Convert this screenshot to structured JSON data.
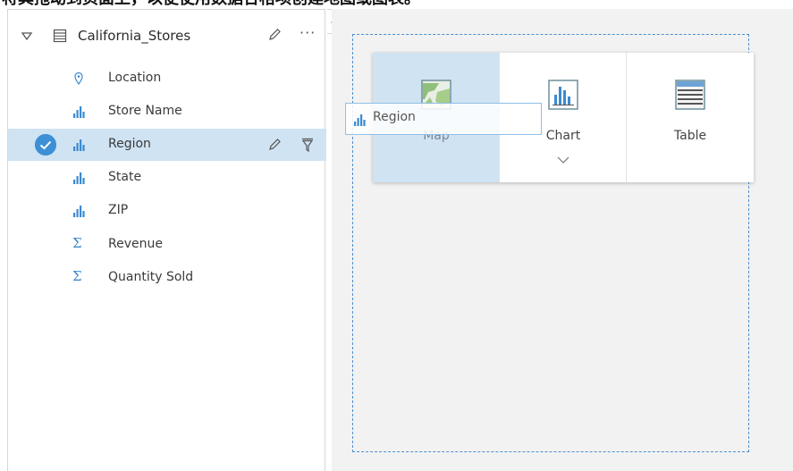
{
  "caption": "将其拖动到页面上，以便使用数据合格项创建地图或图表。",
  "dataset": {
    "name": "California_Stores",
    "more_label": "···"
  },
  "fields": [
    {
      "label": "Location",
      "icon": "location-icon"
    },
    {
      "label": "Store Name",
      "icon": "string-field-icon"
    },
    {
      "label": "Region",
      "icon": "string-field-icon",
      "selected": true
    },
    {
      "label": "State",
      "icon": "string-field-icon"
    },
    {
      "label": "ZIP",
      "icon": "string-field-icon"
    },
    {
      "label": "Revenue",
      "icon": "sigma-icon",
      "glyph": "Σ"
    },
    {
      "label": "Quantity Sold",
      "icon": "sigma-icon",
      "glyph": "Σ"
    }
  ],
  "chooser": {
    "map_label": "Map",
    "chart_label": "Chart",
    "table_label": "Table"
  },
  "drag": {
    "label": "Region"
  },
  "colors": {
    "accent": "#3d8fd6",
    "selected_bg": "#cfe3f3",
    "field_icon": "#3b8ad0"
  }
}
